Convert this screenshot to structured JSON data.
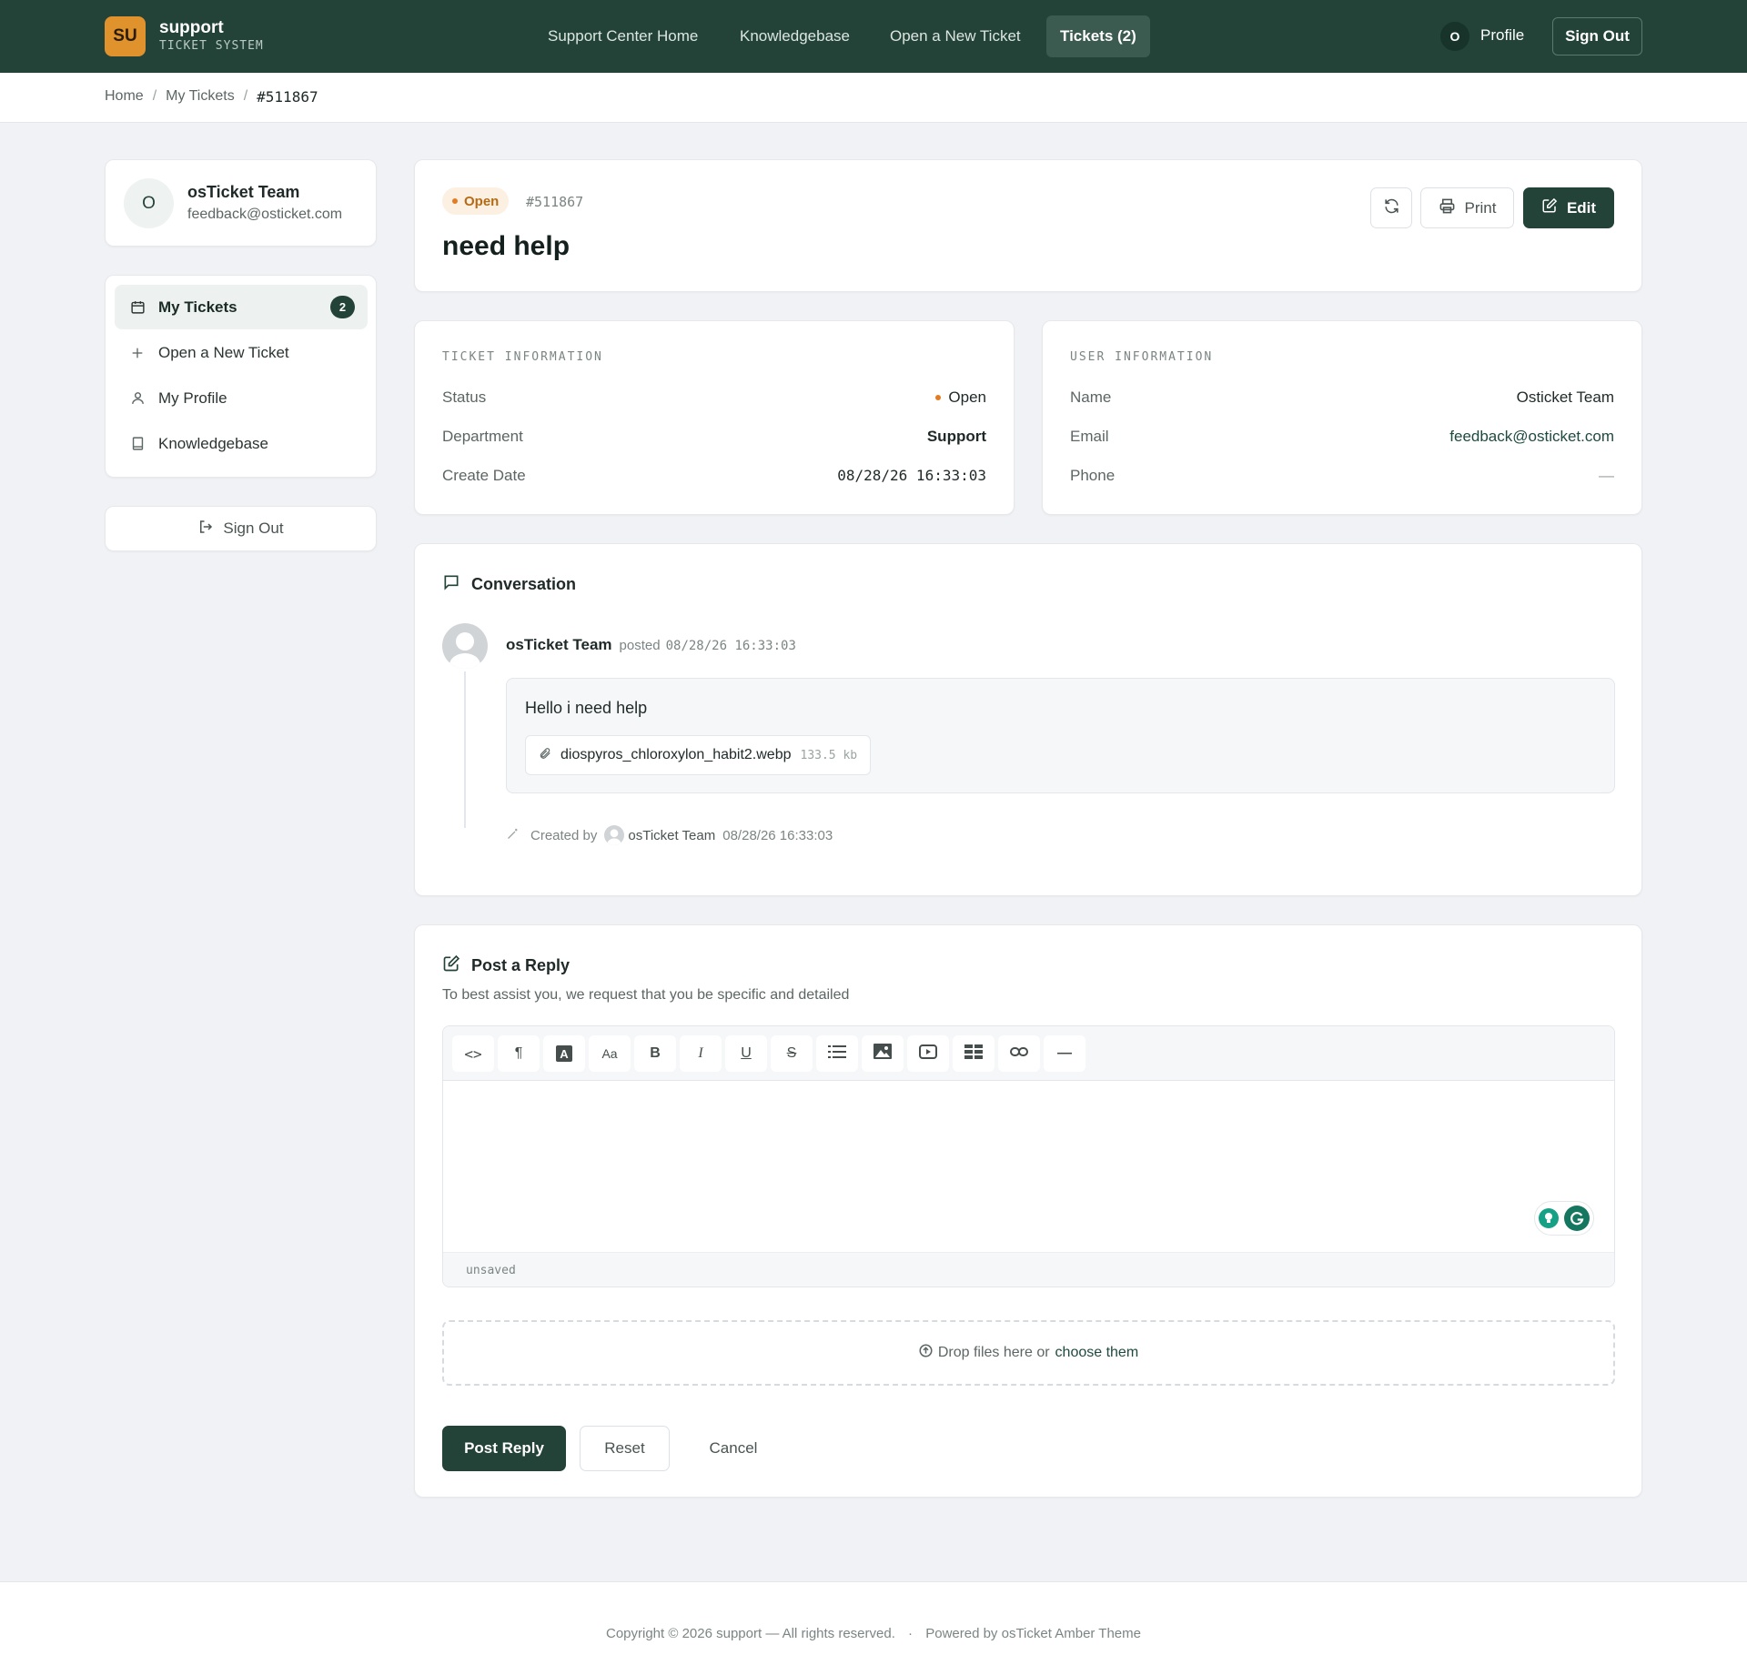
{
  "header": {
    "logo_initials": "SU",
    "brand_name": "support",
    "brand_subtitle": "TICKET SYSTEM",
    "nav": [
      {
        "label": "Support Center Home"
      },
      {
        "label": "Knowledgebase"
      },
      {
        "label": "Open a New Ticket"
      },
      {
        "label": "Tickets (2)"
      }
    ],
    "profile_initial": "O",
    "profile_label": "Profile",
    "sign_out_label": "Sign Out"
  },
  "breadcrumb": {
    "items": [
      "Home",
      "My Tickets",
      "#511867"
    ],
    "separator": "/"
  },
  "sidebar": {
    "user_initial": "O",
    "user_name": "osTicket Team",
    "user_email": "feedback@osticket.com",
    "items": [
      {
        "label": "My Tickets",
        "icon": "calendar-icon",
        "count": "2"
      },
      {
        "label": "Open a New Ticket",
        "icon": "plus-icon"
      },
      {
        "label": "My Profile",
        "icon": "user-icon"
      },
      {
        "label": "Knowledgebase",
        "icon": "book-icon"
      }
    ],
    "sign_out_label": "Sign Out"
  },
  "ticket": {
    "status": "Open",
    "number": "#511867",
    "subject": "need help",
    "print_label": "Print",
    "edit_label": "Edit"
  },
  "ticket_info": {
    "title": "TICKET INFORMATION",
    "rows": [
      {
        "label": "Status",
        "value": "Open"
      },
      {
        "label": "Department",
        "value": "Support"
      },
      {
        "label": "Create Date",
        "value": "08/28/26 16:33:03"
      }
    ]
  },
  "user_info": {
    "title": "USER INFORMATION",
    "rows": [
      {
        "label": "Name",
        "value": "Osticket Team"
      },
      {
        "label": "Email",
        "value": "feedback@osticket.com"
      },
      {
        "label": "Phone",
        "value": "—"
      }
    ]
  },
  "conversation": {
    "title": "Conversation",
    "entry": {
      "author": "osTicket Team",
      "posted_label": "posted",
      "posted_at": "08/28/26 16:33:03",
      "message": "Hello i need help",
      "attachment_name": "diospyros_chloroxylon_habit2.webp",
      "attachment_size": "133.5 kb"
    },
    "event": {
      "created_by_label": "Created by",
      "author": "osTicket Team",
      "time": "08/28/26 16:33:03"
    }
  },
  "reply": {
    "title": "Post a Reply",
    "subtitle": "To best assist you, we request that you be specific and detailed",
    "toolbar": [
      "<>",
      "¶",
      "A",
      "Aa",
      "B",
      "I",
      "U",
      "S",
      "list",
      "image",
      "video",
      "table",
      "link",
      "—"
    ],
    "status_text": "unsaved",
    "drop_text": "Drop files here or",
    "drop_link": "choose them",
    "post_label": "Post Reply",
    "reset_label": "Reset",
    "cancel_label": "Cancel"
  },
  "footer": {
    "copyright": "Copyright © 2026 support — All rights reserved.",
    "separator": "·",
    "powered": "Powered by osTicket Amber Theme"
  },
  "colors": {
    "brand_dark": "#234238",
    "accent_orange": "#e0922c",
    "status_open": "#e07d22"
  }
}
